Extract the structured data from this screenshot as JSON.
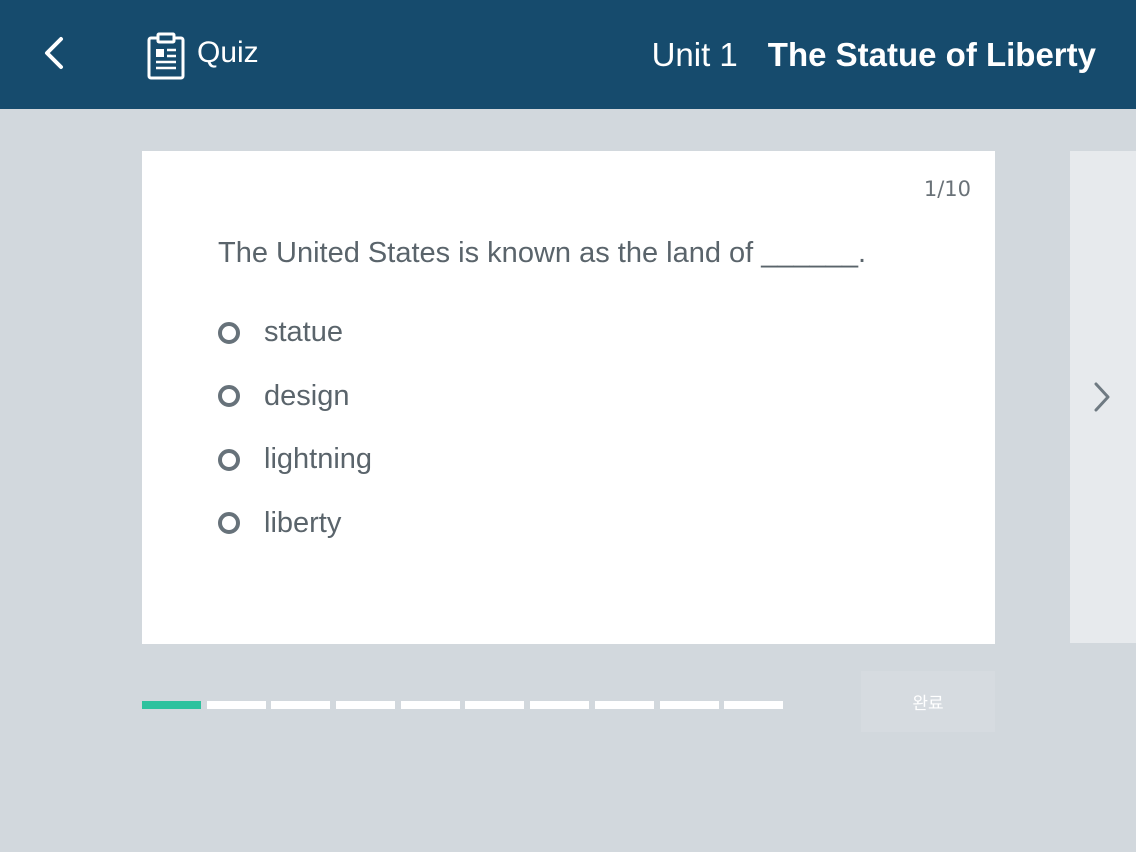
{
  "header": {
    "section_label": "Quiz",
    "unit_label": "Unit 1",
    "lesson_title": "The Statue of Liberty",
    "icons": {
      "back": "chevron-left-icon",
      "quiz": "clipboard-icon"
    }
  },
  "quiz": {
    "counter": "1/10",
    "question": "The United States is known as the land of ______.",
    "options": [
      {
        "label": "statue"
      },
      {
        "label": "design"
      },
      {
        "label": "lightning"
      },
      {
        "label": "liberty"
      }
    ]
  },
  "progress": {
    "current": 1,
    "total": 10
  },
  "footer": {
    "complete_label": "완료"
  },
  "colors": {
    "header_bg": "#164b6d",
    "page_bg": "#d2d8dd",
    "progress_active": "#2ec29e",
    "progress_inactive": "#ffffff"
  }
}
